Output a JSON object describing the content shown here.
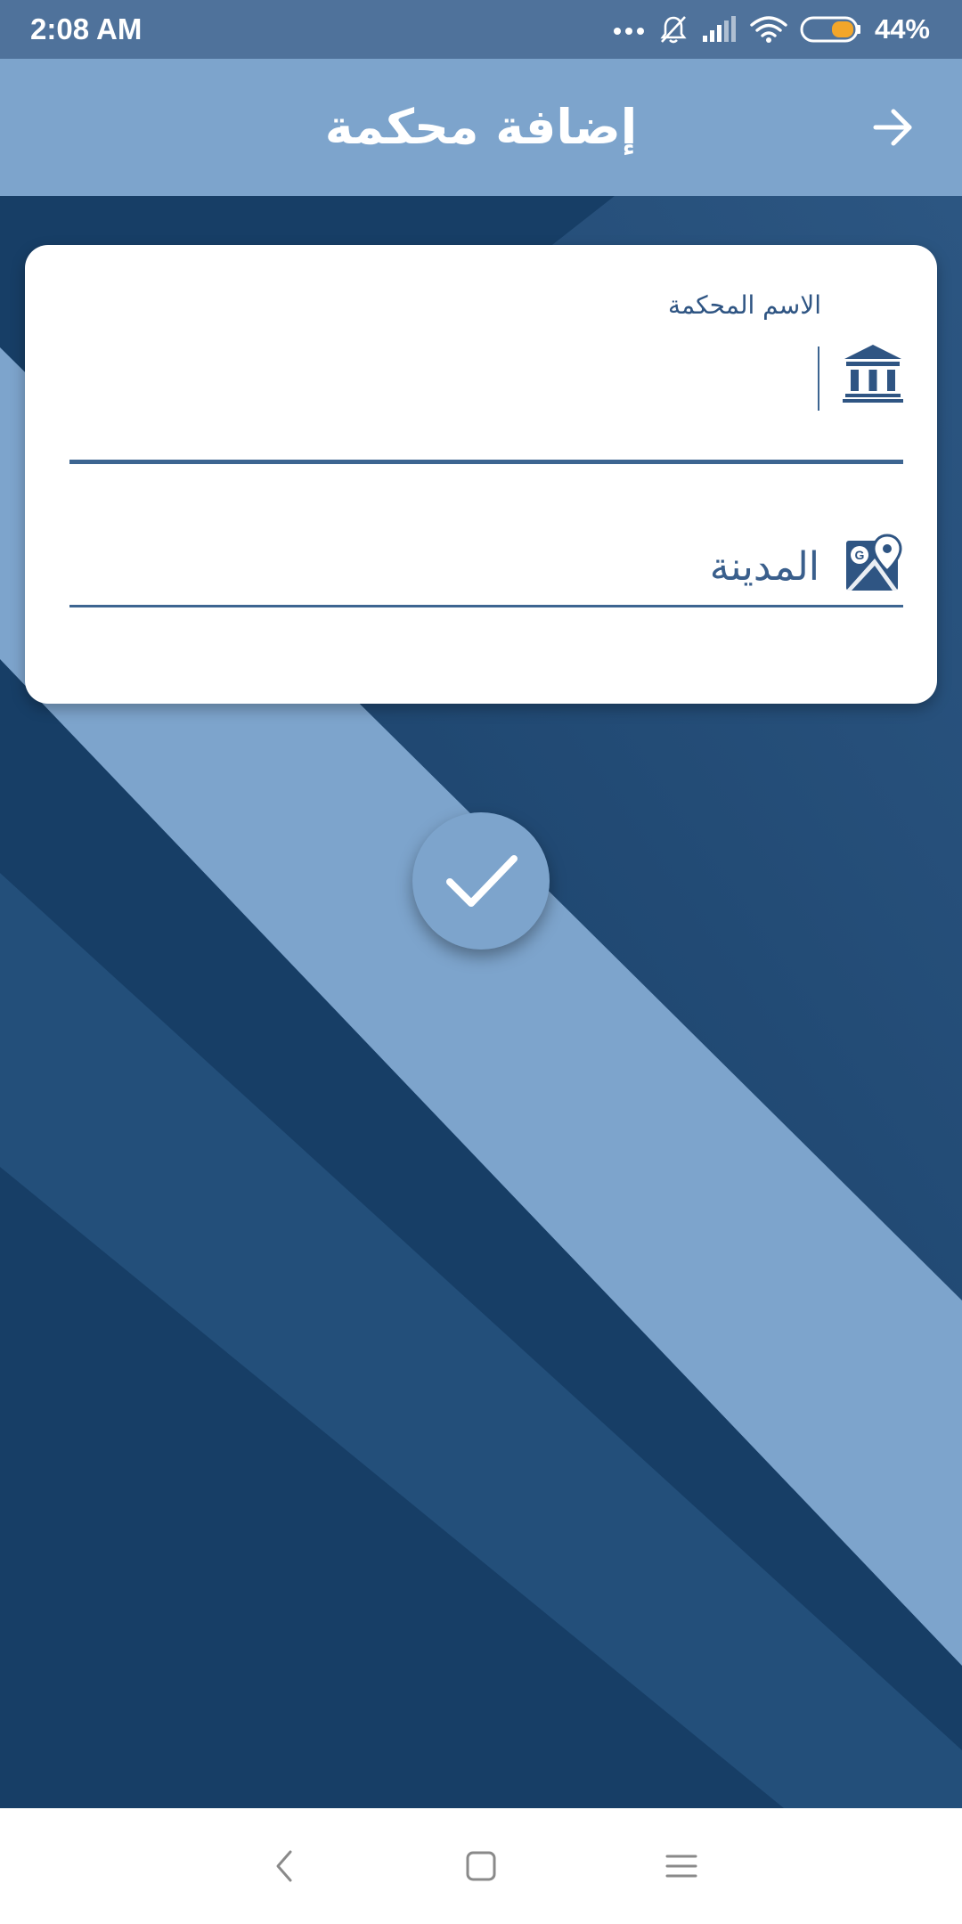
{
  "status_bar": {
    "time": "2:08 AM",
    "battery_percent": "44%",
    "icons": [
      "more-dots-icon",
      "notifications-off-icon",
      "signal-icon",
      "wifi-icon",
      "battery-icon"
    ],
    "battery_level": 0.44
  },
  "app_bar": {
    "title": "إضافة محكمة",
    "back_icon": "arrow-right-icon"
  },
  "form": {
    "court_name": {
      "label": "الاسم المحكمة",
      "value": "",
      "icon": "courthouse-icon"
    },
    "city": {
      "placeholder": "المدينة",
      "value": "",
      "icon": "map-location-icon"
    }
  },
  "submit": {
    "icon": "checkmark-icon"
  },
  "nav_bar": {
    "buttons": [
      "back-icon",
      "home-icon",
      "recents-icon"
    ]
  },
  "colors": {
    "status_bar": "#4f729b",
    "app_bar": "#7da4cc",
    "background_dark": "#173e66",
    "stripe_light": "#7da4cc",
    "field_accent": "#3d6591",
    "card": "#ffffff"
  }
}
